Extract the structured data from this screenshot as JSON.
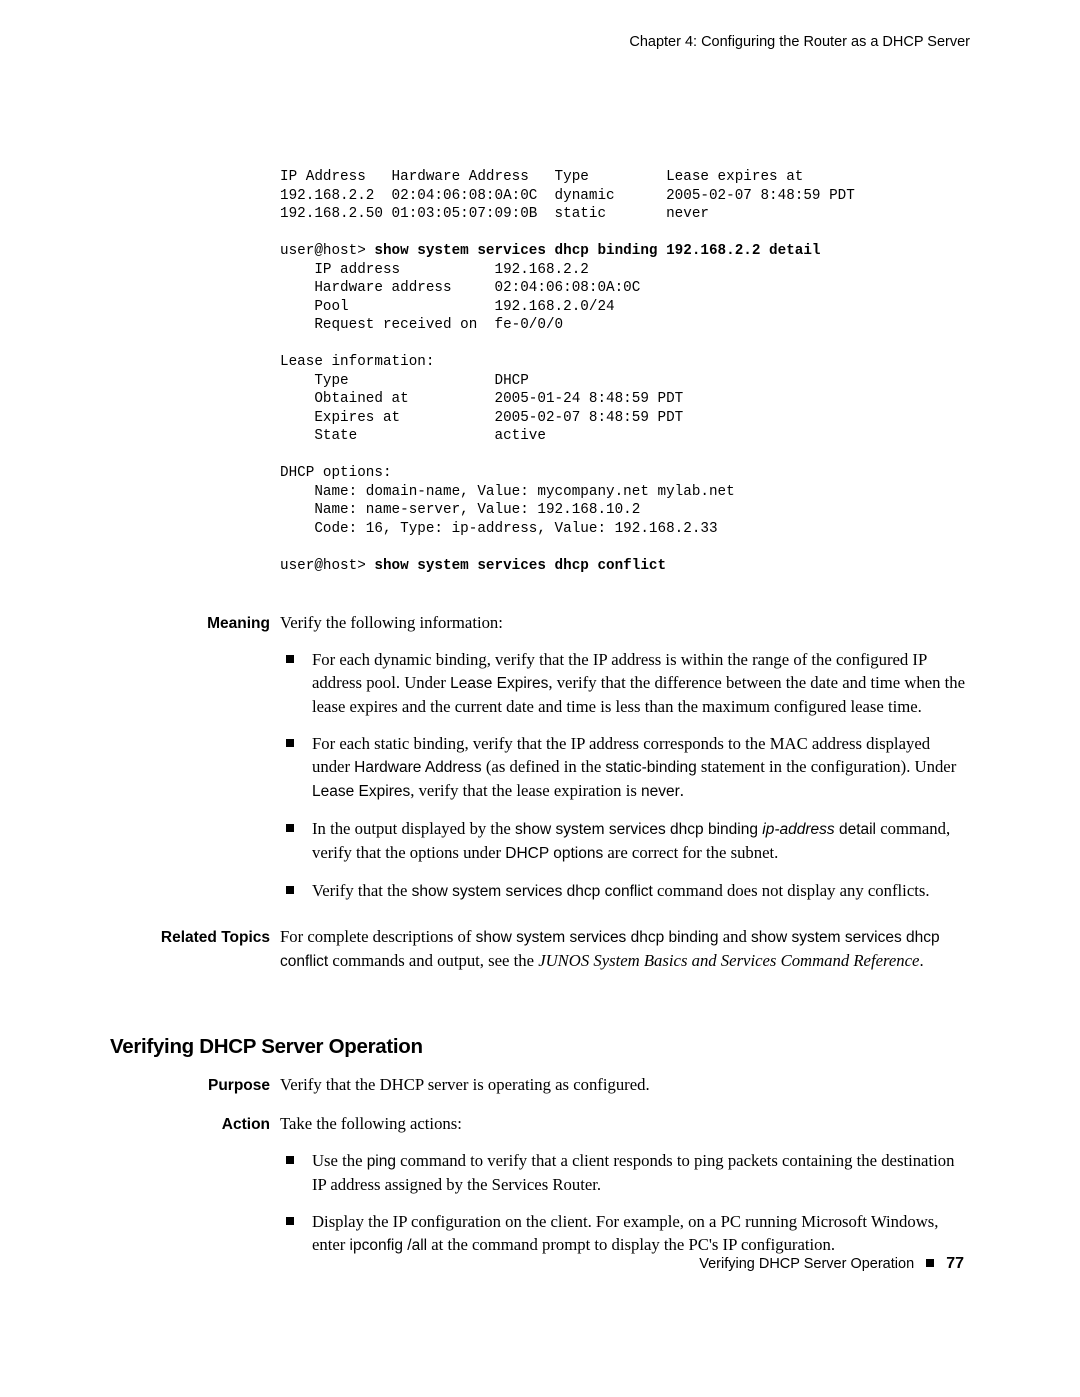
{
  "header": {
    "chapter": "Chapter 4: Configuring the Router as a DHCP Server"
  },
  "cli": {
    "row_hdr": "IP Address   Hardware Address   Type         Lease expires at",
    "row1": "192.168.2.2  02:04:06:08:0A:0C  dynamic      2005-02-07 8:48:59 PDT",
    "row2": "192.168.2.50 01:03:05:07:09:0B  static       never",
    "prompt1a": "user@host> ",
    "prompt1b": "show system services dhcp binding 192.168.2.2 detail",
    "d1": "    IP address           192.168.2.2",
    "d2": "    Hardware address     02:04:06:08:0A:0C",
    "d3": "    Pool                 192.168.2.0/24",
    "d4": "    Request received on  fe-0/0/0",
    "li_h": "Lease information:",
    "li1": "    Type                 DHCP",
    "li2": "    Obtained at          2005-01-24 8:48:59 PDT",
    "li3": "    Expires at           2005-02-07 8:48:59 PDT",
    "li4": "    State                active",
    "do_h": "DHCP options:",
    "do1": "    Name: domain-name, Value: mycompany.net mylab.net",
    "do2": "    Name: name-server, Value: 192.168.10.2",
    "do3": "    Code: 16, Type: ip-address, Value: 192.168.2.33",
    "prompt2a": "user@host> ",
    "prompt2b": "show system services dhcp conflict"
  },
  "meaning": {
    "label": "Meaning",
    "intro": "Verify the following information:",
    "b1a": "For each dynamic binding, verify that the IP address is within the range of the configured IP address pool. Under ",
    "b1b": "Lease Expires",
    "b1c": ", verify that the difference between the date and time when the lease expires and the current date and time is less than the maximum configured lease time.",
    "b2a": "For each static binding, verify that the IP address corresponds to the MAC address displayed under ",
    "b2b": "Hardware Address",
    "b2c": " (as defined in the ",
    "b2d": "static-binding",
    "b2e": " statement in the configuration). Under ",
    "b2f": "Lease Expires",
    "b2g": ", verify that the lease expiration is ",
    "b2h": "never",
    "b2i": ".",
    "b3a": "In the output displayed by the ",
    "b3b": "show system services dhcp binding ",
    "b3c": "ip-address",
    "b3d": " detail",
    "b3e": " command, verify that the options under ",
    "b3f": "DHCP options",
    "b3g": " are correct for the subnet.",
    "b4a": "Verify that the ",
    "b4b": "show system services dhcp conflict",
    "b4c": " command does not display any conflicts."
  },
  "related": {
    "label": "Related Topics",
    "a": "For complete descriptions of ",
    "b": "show system services dhcp binding",
    "c": " and ",
    "d": "show system services dhcp conflict",
    "e": " commands and output, see the ",
    "f": "JUNOS System Basics and Services Command Reference",
    "g": "."
  },
  "section": {
    "title": "Verifying DHCP Server Operation"
  },
  "purpose": {
    "label": "Purpose",
    "text": "Verify that the DHCP server is operating as configured."
  },
  "action": {
    "label": "Action",
    "intro": "Take the following actions:",
    "b1a": "Use the ",
    "b1b": "ping",
    "b1c": " command to verify that a client responds to ping packets containing the destination IP address assigned by the Services Router.",
    "b2a": "Display the IP configuration on the client. For example, on a PC running Microsoft Windows, enter ",
    "b2b": "ipconfig /all",
    "b2c": " at the command prompt to display the PC's IP configuration."
  },
  "footer": {
    "text": "Verifying DHCP Server Operation",
    "page": "77"
  }
}
